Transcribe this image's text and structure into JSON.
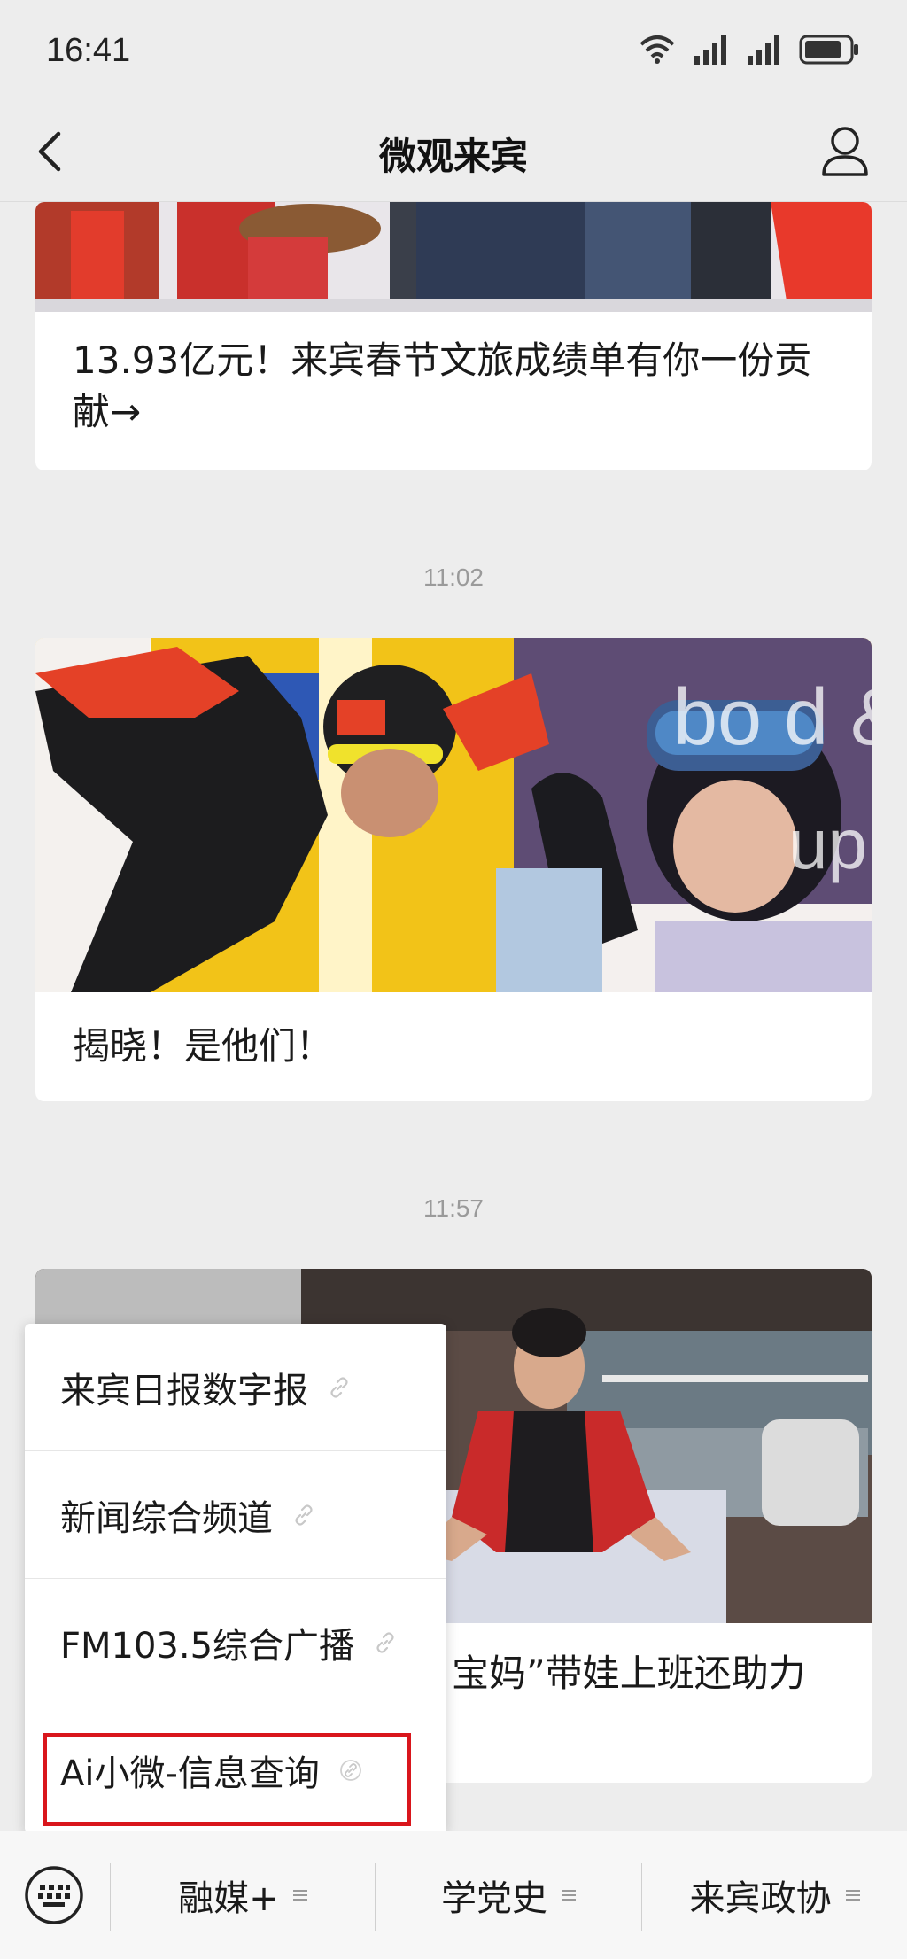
{
  "status_bar": {
    "time": "16:41",
    "icons": [
      "wifi-icon",
      "signal-icon",
      "signal-icon",
      "battery-icon"
    ]
  },
  "nav": {
    "title": "微观来宾",
    "back_icon": "chevron-left-icon",
    "profile_icon": "user-icon"
  },
  "feed": [
    {
      "timestamp": "",
      "title": "13.93亿元！来宾春节文旅成绩单有你一份贡献→",
      "image_desc": "festival-crowd-photo"
    },
    {
      "timestamp": "11:02",
      "title": "揭晓！是他们！",
      "image_desc": "athletes-photo"
    },
    {
      "timestamp": "11:57",
      "title": "宝妈”带娃上班还助力",
      "image_desc": "factory-worker-photo"
    }
  ],
  "menu_popup": {
    "items": [
      {
        "label": "来宾日报数字报",
        "icon": "link-icon"
      },
      {
        "label": "新闻综合频道",
        "icon": "link-icon"
      },
      {
        "label": "FM103.5综合广播",
        "icon": "link-icon"
      },
      {
        "label": "Ai小微-信息查询",
        "icon": "link-icon",
        "highlighted": true
      }
    ],
    "highlight_color": "#d9161c"
  },
  "bottom_bar": {
    "keyboard_icon": "keyboard-icon",
    "tabs": [
      {
        "label": "融媒+",
        "icon": "menu-lines-icon"
      },
      {
        "label": "学党史",
        "icon": "menu-lines-icon"
      },
      {
        "label": "来宾政协",
        "icon": "menu-lines-icon"
      }
    ]
  }
}
